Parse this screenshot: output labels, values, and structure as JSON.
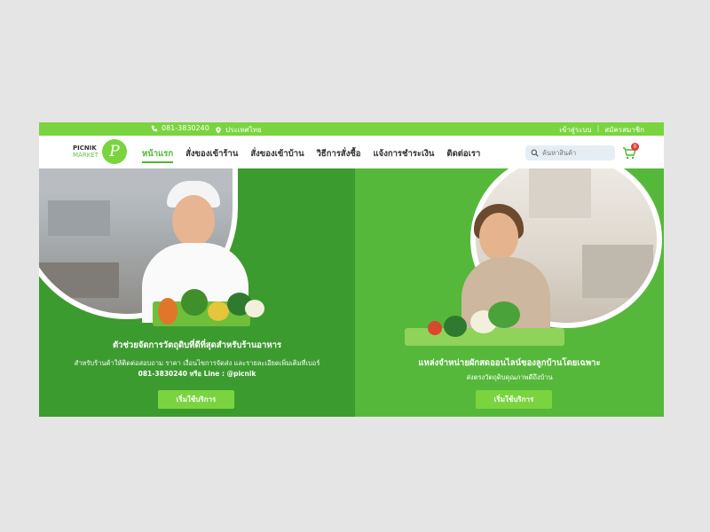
{
  "topbar": {
    "phone": "081-3830240",
    "country": "ประเทศไทย",
    "login": "เข้าสู่ระบบ",
    "register": "สมัครสมาชิก"
  },
  "nav": {
    "logo": {
      "line1": "PICNIK",
      "line2": "MARKET",
      "mark": "P"
    },
    "menu": [
      {
        "label": "หน้าแรก",
        "active": true
      },
      {
        "label": "สั่งของเข้าร้าน"
      },
      {
        "label": "สั่งของเข้าบ้าน"
      },
      {
        "label": "วิธีการสั่งซื้อ"
      },
      {
        "label": "แจ้งการชำระเงิน"
      },
      {
        "label": "ติดต่อเรา"
      }
    ],
    "search_placeholder": "ค้นหาสินค้า",
    "cart_count": "0"
  },
  "hero": {
    "left": {
      "headline": "ตัวช่วยจัดการวัตถุดิบที่ดีที่สุดสำหรับร้านอาหาร",
      "sub1": "สำหรับร้านค้าให้ติดต่อสอบถาม ราคา เงื่อนไขการจัดส่ง และรายละเอียดเพิ่มเติมที่เบอร์",
      "sub2": "081-3830240 หรือ Line : @picnik",
      "cta": "เริ่มใช้บริการ"
    },
    "right": {
      "headline": "แหล่งจำหน่ายผักสดออนไลน์ของลูกบ้านโดยเฉพาะ",
      "sub1": "ส่งตรงวัตถุดิบคุณภาพดีถึงบ้าน",
      "cta": "เริ่มใช้บริการ"
    }
  },
  "colors": {
    "brand_green": "#7ad43f",
    "left_panel": "#3c9b2f",
    "right_panel": "#56b83a",
    "cart_badge": "#e53935"
  },
  "icons": {
    "phone": "phone-icon",
    "location": "location-pin-icon",
    "search": "search-icon",
    "cart": "cart-icon"
  }
}
